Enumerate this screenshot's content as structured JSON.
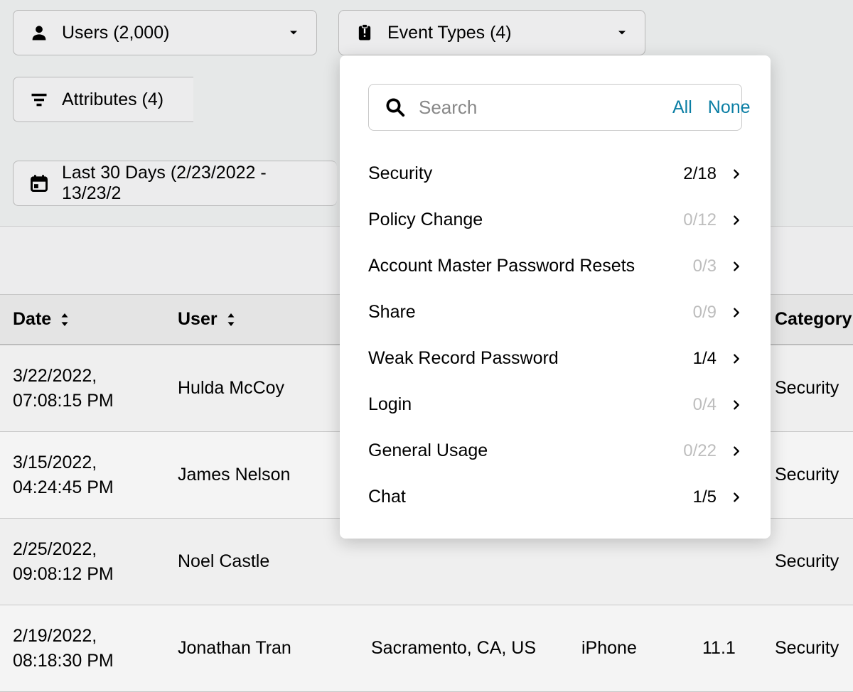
{
  "filters": {
    "users": {
      "label": "Users (2,000)"
    },
    "event_types": {
      "label": "Event Types (4)"
    },
    "attributes": {
      "label": "Attributes (4)"
    },
    "date_range": {
      "label": "Last 30 Days (2/23/2022 - 13/23/2"
    }
  },
  "dropdown": {
    "search_placeholder": "Search",
    "all_label": "All",
    "none_label": "None",
    "options": [
      {
        "label": "Security",
        "count": "2/18",
        "zero": false
      },
      {
        "label": "Policy Change",
        "count": "0/12",
        "zero": true
      },
      {
        "label": "Account Master Password Resets",
        "count": "0/3",
        "zero": true
      },
      {
        "label": "Share",
        "count": "0/9",
        "zero": true
      },
      {
        "label": "Weak Record Password",
        "count": "1/4",
        "zero": false
      },
      {
        "label": "Login",
        "count": "0/4",
        "zero": true
      },
      {
        "label": "General Usage",
        "count": "0/22",
        "zero": true
      },
      {
        "label": "Chat",
        "count": "1/5",
        "zero": false
      }
    ]
  },
  "table": {
    "headers": {
      "date": "Date",
      "user": "User",
      "category": "Category"
    },
    "rows": [
      {
        "date": "3/22/2022,",
        "time": "07:08:15 PM",
        "user": "Hulda McCoy",
        "location": "",
        "device": "",
        "version": "",
        "category": "Security"
      },
      {
        "date": "3/15/2022,",
        "time": "04:24:45 PM",
        "user": "James Nelson",
        "location": "",
        "device": "",
        "version": "",
        "category": "Security"
      },
      {
        "date": "2/25/2022,",
        "time": "09:08:12 PM",
        "user": "Noel Castle",
        "location": "",
        "device": "",
        "version": "",
        "category": "Security"
      },
      {
        "date": "2/19/2022,",
        "time": "08:18:30 PM",
        "user": "Jonathan Tran",
        "location": "Sacramento, CA, US",
        "device": "iPhone",
        "version": "11.1",
        "category": "Security"
      }
    ]
  }
}
